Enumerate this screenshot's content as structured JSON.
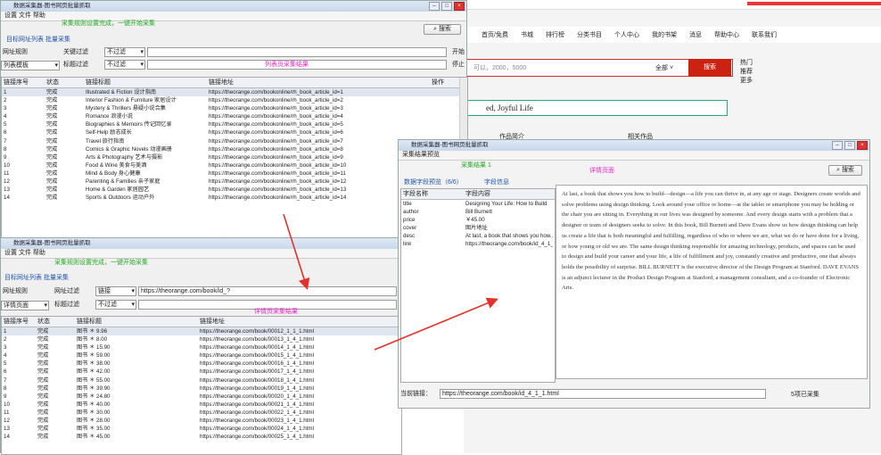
{
  "web": {
    "nav": [
      "首页/免费",
      "书城",
      "排行榜",
      "分类书目",
      "个人中心",
      "我的书架",
      "消息",
      "帮助中心",
      "联系我们"
    ],
    "search_placeholder": "可以，2000，5000",
    "search_filter": "全部 ˅",
    "search_button": "搜索",
    "side_links": [
      "热门",
      "推荐",
      "更多"
    ],
    "book_title": "ed, Joyful Life",
    "link_left": "作品简介",
    "link_right": "相关作品"
  },
  "win1": {
    "title": "数据采集器-图书网页批量抓取",
    "menu": "设置 文件 帮助",
    "banner": "采集规则设置完成，一键开始采集",
    "search_btn": "搜索",
    "tab": "目标网址列表  批量采集",
    "label_url": "网址规则",
    "label_filter1": "关键过滤",
    "label_filter2": "标题过滤",
    "filter1_value": "不过滤",
    "filter2_value": "不过滤",
    "mode_value": "列表模板",
    "side_btn1": "开始",
    "side_btn2": "停止",
    "center_tag": "列表页采集结果",
    "headers": [
      "链接序号",
      "状态",
      "链接标题",
      "链接地址",
      "操作"
    ],
    "rows": [
      [
        "1",
        "完成",
        "Illustrated & Fiction 设计指南",
        "https://theorange.com/bookonline/rh_book_article_id=1"
      ],
      [
        "2",
        "完成",
        "Interior Fashion & Furniture 家居设计",
        "https://theorange.com/bookonline/rh_book_article_id=2"
      ],
      [
        "3",
        "完成",
        "Mystery & Thrillers 悬疑小说合集",
        "https://theorange.com/bookonline/rh_book_article_id=3"
      ],
      [
        "4",
        "完成",
        "Romance 浪漫小说",
        "https://theorange.com/bookonline/rh_book_article_id=4"
      ],
      [
        "5",
        "完成",
        "Biographies & Memoirs 传记回忆录",
        "https://theorange.com/bookonline/rh_book_article_id=5"
      ],
      [
        "6",
        "完成",
        "Self-Help 励志成长",
        "https://theorange.com/bookonline/rh_book_article_id=6"
      ],
      [
        "7",
        "完成",
        "Travel 旅行指南",
        "https://theorange.com/bookonline/rh_book_article_id=7"
      ],
      [
        "8",
        "完成",
        "Comics & Graphic Novels 动漫画册",
        "https://theorange.com/bookonline/rh_book_article_id=8"
      ],
      [
        "9",
        "完成",
        "Arts & Photography 艺术与摄影",
        "https://theorange.com/bookonline/rh_book_article_id=9"
      ],
      [
        "10",
        "完成",
        "Food & Wine 美食与美酒",
        "https://theorange.com/bookonline/rh_book_article_id=10"
      ],
      [
        "11",
        "完成",
        "Mind & Body 身心健康",
        "https://theorange.com/bookonline/rh_book_article_id=11"
      ],
      [
        "12",
        "完成",
        "Parenting & Families 亲子家庭",
        "https://theorange.com/bookonline/rh_book_article_id=12"
      ],
      [
        "13",
        "完成",
        "Home & Garden 家居园艺",
        "https://theorange.com/bookonline/rh_book_article_id=13"
      ],
      [
        "14",
        "完成",
        "Sports & Outdoors 运动户外",
        "https://theorange.com/bookonline/rh_book_article_id=14"
      ]
    ]
  },
  "win2": {
    "title": "数据采集器-图书网页批量抓取",
    "menu": "设置 文件 帮助",
    "banner": "采集规则设置完成，一键开始采集",
    "tab": "目标网址列表  批量采集",
    "label_url": "网址规则",
    "label_filter1": "网址过滤",
    "label_filter2": "标题过滤",
    "url_mode": "链接",
    "url_value": "https://theorange.com/book/id_?",
    "filter2_value": "不过滤",
    "mode_value": "详情页面",
    "center_tag": "详情页采集结果",
    "headers": [
      "链接序号",
      "状态",
      "链接标题",
      "链接地址"
    ],
    "rows": [
      [
        "1",
        "完成",
        "图书 ＊ 9.96",
        "https://theorange.com/book/00012_1_1_1.html"
      ],
      [
        "2",
        "完成",
        "图书 ＊ 8.00",
        "https://theorange.com/book/00013_1_4_1.html"
      ],
      [
        "3",
        "完成",
        "图书 ＊ 15.90",
        "https://theorange.com/book/00014_1_4_1.html"
      ],
      [
        "4",
        "完成",
        "图书 ＊ 59.00",
        "https://theorange.com/book/00015_1_4_1.html"
      ],
      [
        "5",
        "完成",
        "图书 ＊ 38.00",
        "https://theorange.com/book/00016_1_4_1.html"
      ],
      [
        "6",
        "完成",
        "图书 ＊ 42.00",
        "https://theorange.com/book/00017_1_4_1.html"
      ],
      [
        "7",
        "完成",
        "图书 ＊ 55.00",
        "https://theorange.com/book/00018_1_4_1.html"
      ],
      [
        "8",
        "完成",
        "图书 ＊ 39.90",
        "https://theorange.com/book/00019_1_4_1.html"
      ],
      [
        "9",
        "完成",
        "图书 ＊ 24.80",
        "https://theorange.com/book/00020_1_4_1.html"
      ],
      [
        "10",
        "完成",
        "图书 ＊ 40.00",
        "https://theorange.com/book/00021_1_4_1.html"
      ],
      [
        "11",
        "完成",
        "图书 ＊ 30.00",
        "https://theorange.com/book/00022_1_4_1.html"
      ],
      [
        "12",
        "完成",
        "图书 ＊ 28.00",
        "https://theorange.com/book/00023_1_4_1.html"
      ],
      [
        "13",
        "完成",
        "图书 ＊ 35.00",
        "https://theorange.com/book/00024_1_4_1.html"
      ],
      [
        "14",
        "完成",
        "图书 ＊ 45.00",
        "https://theorange.com/book/00025_1_4_1.html"
      ]
    ]
  },
  "win3": {
    "title": "数据采集器-图书网页批量抓取",
    "menu": "采集结果预览",
    "banner": "采集结果 1",
    "search_btn": "搜索",
    "center_tag": "详情页面",
    "tab": "数据字段预览（6/6）",
    "tab2": "字段信息",
    "headers": [
      "字段名称",
      "字段内容"
    ],
    "rows": [
      [
        "title",
        "Designing Your Life: How to Build"
      ],
      [
        "author",
        "Bill Burnett"
      ],
      [
        "price",
        "￥45.00"
      ],
      [
        "cover",
        "图片地址"
      ],
      [
        "desc",
        "At last, a book that shows you how..."
      ],
      [
        "link",
        "https://theorange.com/book/id_4_1_1.html"
      ]
    ],
    "article": "At last, a book that shows you how to build—design—a life you can thrive in, at any age or stage. Designers create worlds and solve problems using design thinking. Look around your office or home—at the tablet or smartphone you may be holding or the chair you are sitting in. Everything in our lives was designed by someone. And every design starts with a problem that a designer or team of designers seeks to solve. In this book, Bill Burnett and Dave Evans show us how design thinking can help us create a life that is both meaningful and fulfilling, regardless of who or where we are, what we do or have done for a living, or how young or old we are. The same design thinking responsible for amazing technology, products, and spaces can be used to design and build your career and your life, a life of fulfillment and joy, constantly creative and productive, one that always holds the possibility of surprise. BILL BURNETT is the executive director of the Design Program at Stanford. DAVE EVANS is an adjunct lecturer in the Product Design Program at Stanford, a management consultant, and a co-founder of Electronic Arts.",
    "status_label": "当前链接：",
    "status_url": "https://theorange.com/book/id_4_1_1.html",
    "status_right": "5项已采集"
  }
}
